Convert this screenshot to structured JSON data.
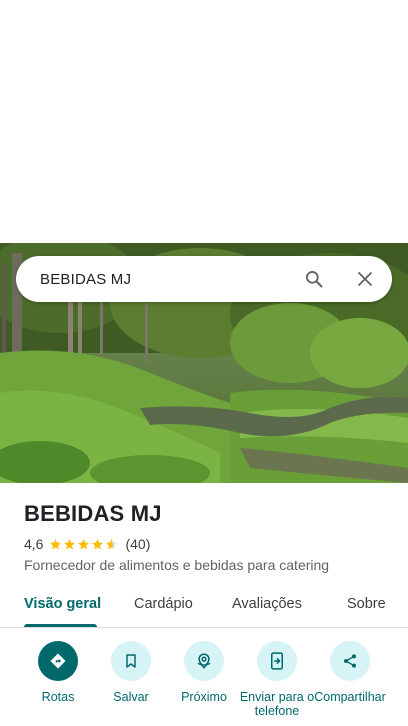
{
  "search": {
    "query": "BEBIDAS MJ"
  },
  "place": {
    "name": "BEBIDAS MJ",
    "rating": "4,6",
    "rating_value": 4.6,
    "review_count": "(40)",
    "category": "Fornecedor de alimentos e bebidas para catering"
  },
  "tabs": [
    {
      "label": "Visão geral",
      "active": true
    },
    {
      "label": "Cardápio",
      "active": false
    },
    {
      "label": "Avaliações",
      "active": false
    },
    {
      "label": "Sobre",
      "active": false
    }
  ],
  "actions": [
    {
      "label": "Rotas",
      "icon": "directions-icon"
    },
    {
      "label": "Salvar",
      "icon": "bookmark-icon"
    },
    {
      "label": "Próximo",
      "icon": "nearby-icon"
    },
    {
      "label": "Enviar para o telefone",
      "icon": "send-to-phone-icon"
    },
    {
      "label": "Compartilhar",
      "icon": "share-icon"
    }
  ],
  "colors": {
    "accent": "#00696b",
    "action_bg": "#d6f3f5",
    "star": "#fbbc04"
  }
}
